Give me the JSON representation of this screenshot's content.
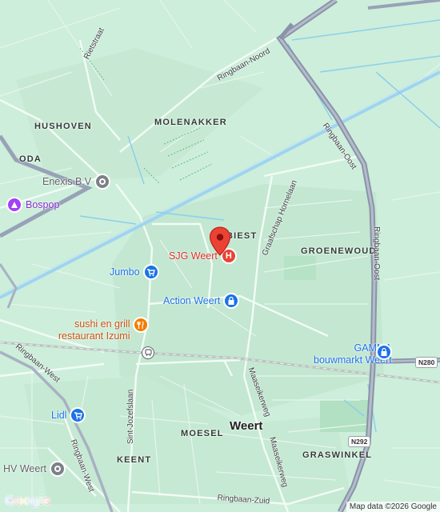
{
  "map": {
    "districts": {
      "hushoven": "HUSHOVEN",
      "oda": "ODA",
      "molenakker": "MOLENAKKER",
      "biest": "BIEST",
      "groenewoud": "GROENEWOUD",
      "moesel": "MOESEL",
      "keent": "KEENT",
      "graswinkel": "GRASWINKEL"
    },
    "city": "Weert",
    "roads": {
      "rietstraat": "Rietstraat",
      "ringbaan_noord": "Ringbaan-Noord",
      "ringbaan_oost_1": "Ringbaan-Oost",
      "ringbaan_oost_2": "Ringbaan-Oost",
      "graafschap_hornelaan": "Graafschap Hornelaan",
      "ringbaan_west_1": "Ringbaan-West",
      "ringbaan_west_2": "Ringbaan-West",
      "sint_jozefslaan": "Sint-Jozefslaan",
      "maaseikerweg_1": "Maaseikerweg",
      "maaseikerweg_2": "Maaseikerweg",
      "ringbaan_zuid": "Ringbaan-Zuid"
    },
    "shields": {
      "n280": "N280",
      "n292": "N292"
    },
    "pois": {
      "enexis": {
        "label": "Enexis B.V",
        "icon": "location-icon",
        "color": "#7b8187"
      },
      "bospop": {
        "label": "Bospop",
        "icon": "venue-icon",
        "color": "#a142f4"
      },
      "jumbo": {
        "label": "Jumbo",
        "icon": "shopping-cart-icon",
        "color": "#1a73e8"
      },
      "sjg": {
        "label": "SJG Weert",
        "icon": "hospital-icon",
        "color": "#ea4335"
      },
      "action": {
        "label": "Action Weert",
        "icon": "shopping-bag-icon",
        "color": "#1a73e8"
      },
      "sushi": {
        "label_line1": "sushi en grill",
        "label_line2": "restaurant Izumi",
        "icon": "restaurant-icon",
        "color": "#f57c00"
      },
      "gamma": {
        "label_line1": "GAMMA",
        "label_line2": "bouwmarkt Weert",
        "icon": "shopping-bag-icon",
        "color": "#1a73e8"
      },
      "lidl": {
        "label": "Lidl",
        "icon": "shopping-cart-icon",
        "color": "#1a73e8"
      },
      "hv_weert": {
        "label": "HV Weert",
        "icon": "location-icon",
        "color": "#7b8187"
      }
    },
    "train_station_icon": "train-icon",
    "selected_pin": {
      "icon": "red-map-pin-icon",
      "color": "#ea4335"
    }
  },
  "footer": {
    "logo": "Google",
    "attribution": "Map data ©2026 Google"
  }
}
